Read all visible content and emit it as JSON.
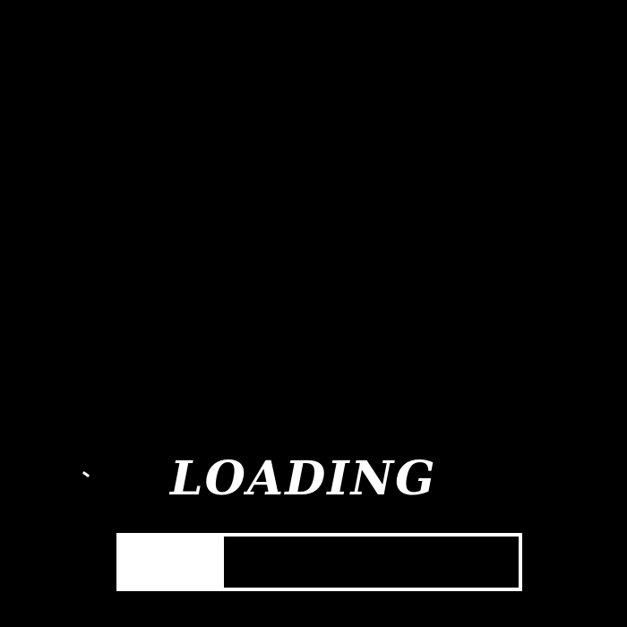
{
  "loading_screen": {
    "title": "LOADING",
    "progress": {
      "fraction": 0.26
    },
    "colors": {
      "background": "#000000",
      "foreground": "#ffffff"
    }
  }
}
